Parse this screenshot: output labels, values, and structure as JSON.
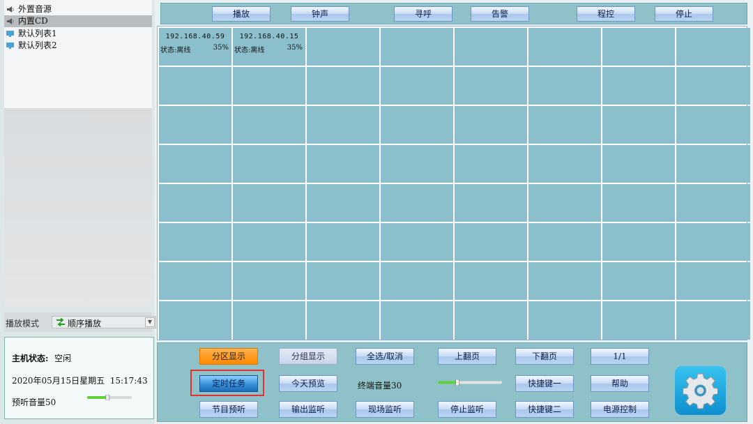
{
  "sources": [
    {
      "label": "外置音源",
      "icon": "speaker-icon",
      "selected": false
    },
    {
      "label": "内置CD",
      "icon": "speaker-icon",
      "selected": true
    },
    {
      "label": "默认列表1",
      "icon": "playlist-icon",
      "selected": false
    },
    {
      "label": "默认列表2",
      "icon": "playlist-icon",
      "selected": false
    }
  ],
  "play_mode": {
    "label": "播放模式",
    "value": "顺序播放"
  },
  "status": {
    "host_label": "主机状态:",
    "host_value": "空闲",
    "datetime": "2020年05月15日星期五  15:17:43",
    "preview_volume_label": "预听音量50",
    "preview_volume": 50
  },
  "toolbar": [
    "播放",
    "钟声",
    "寻呼",
    "告警",
    "程控",
    "停止"
  ],
  "terminals": [
    {
      "ip": "192.168.40.59",
      "status": "状态:离线",
      "volume": "35%"
    },
    {
      "ip": "192.168.40.15",
      "status": "状态:离线",
      "volume": "35%"
    }
  ],
  "controls": {
    "zone_display": "分区显示",
    "group_display": "分组显示",
    "select_all": "全选/取消",
    "prev_page": "上翻页",
    "next_page": "下翻页",
    "page_indicator": "1/1",
    "timed_task": "定时任务",
    "today_preview": "今天预览",
    "terminal_volume_label": "终端音量30",
    "terminal_volume": 30,
    "hotkey_one": "快捷键一",
    "help": "帮助",
    "program_preview": "节目预听",
    "output_monitor": "输出监听",
    "onsite_monitor": "现场监听",
    "stop_monitor": "停止监听",
    "hotkey_two": "快捷键二",
    "power_control": "电源控制"
  },
  "colors": {
    "accent_orange": "#ff8a00",
    "highlight_red": "#e03030",
    "grid_cell": "#8bbfcb"
  }
}
